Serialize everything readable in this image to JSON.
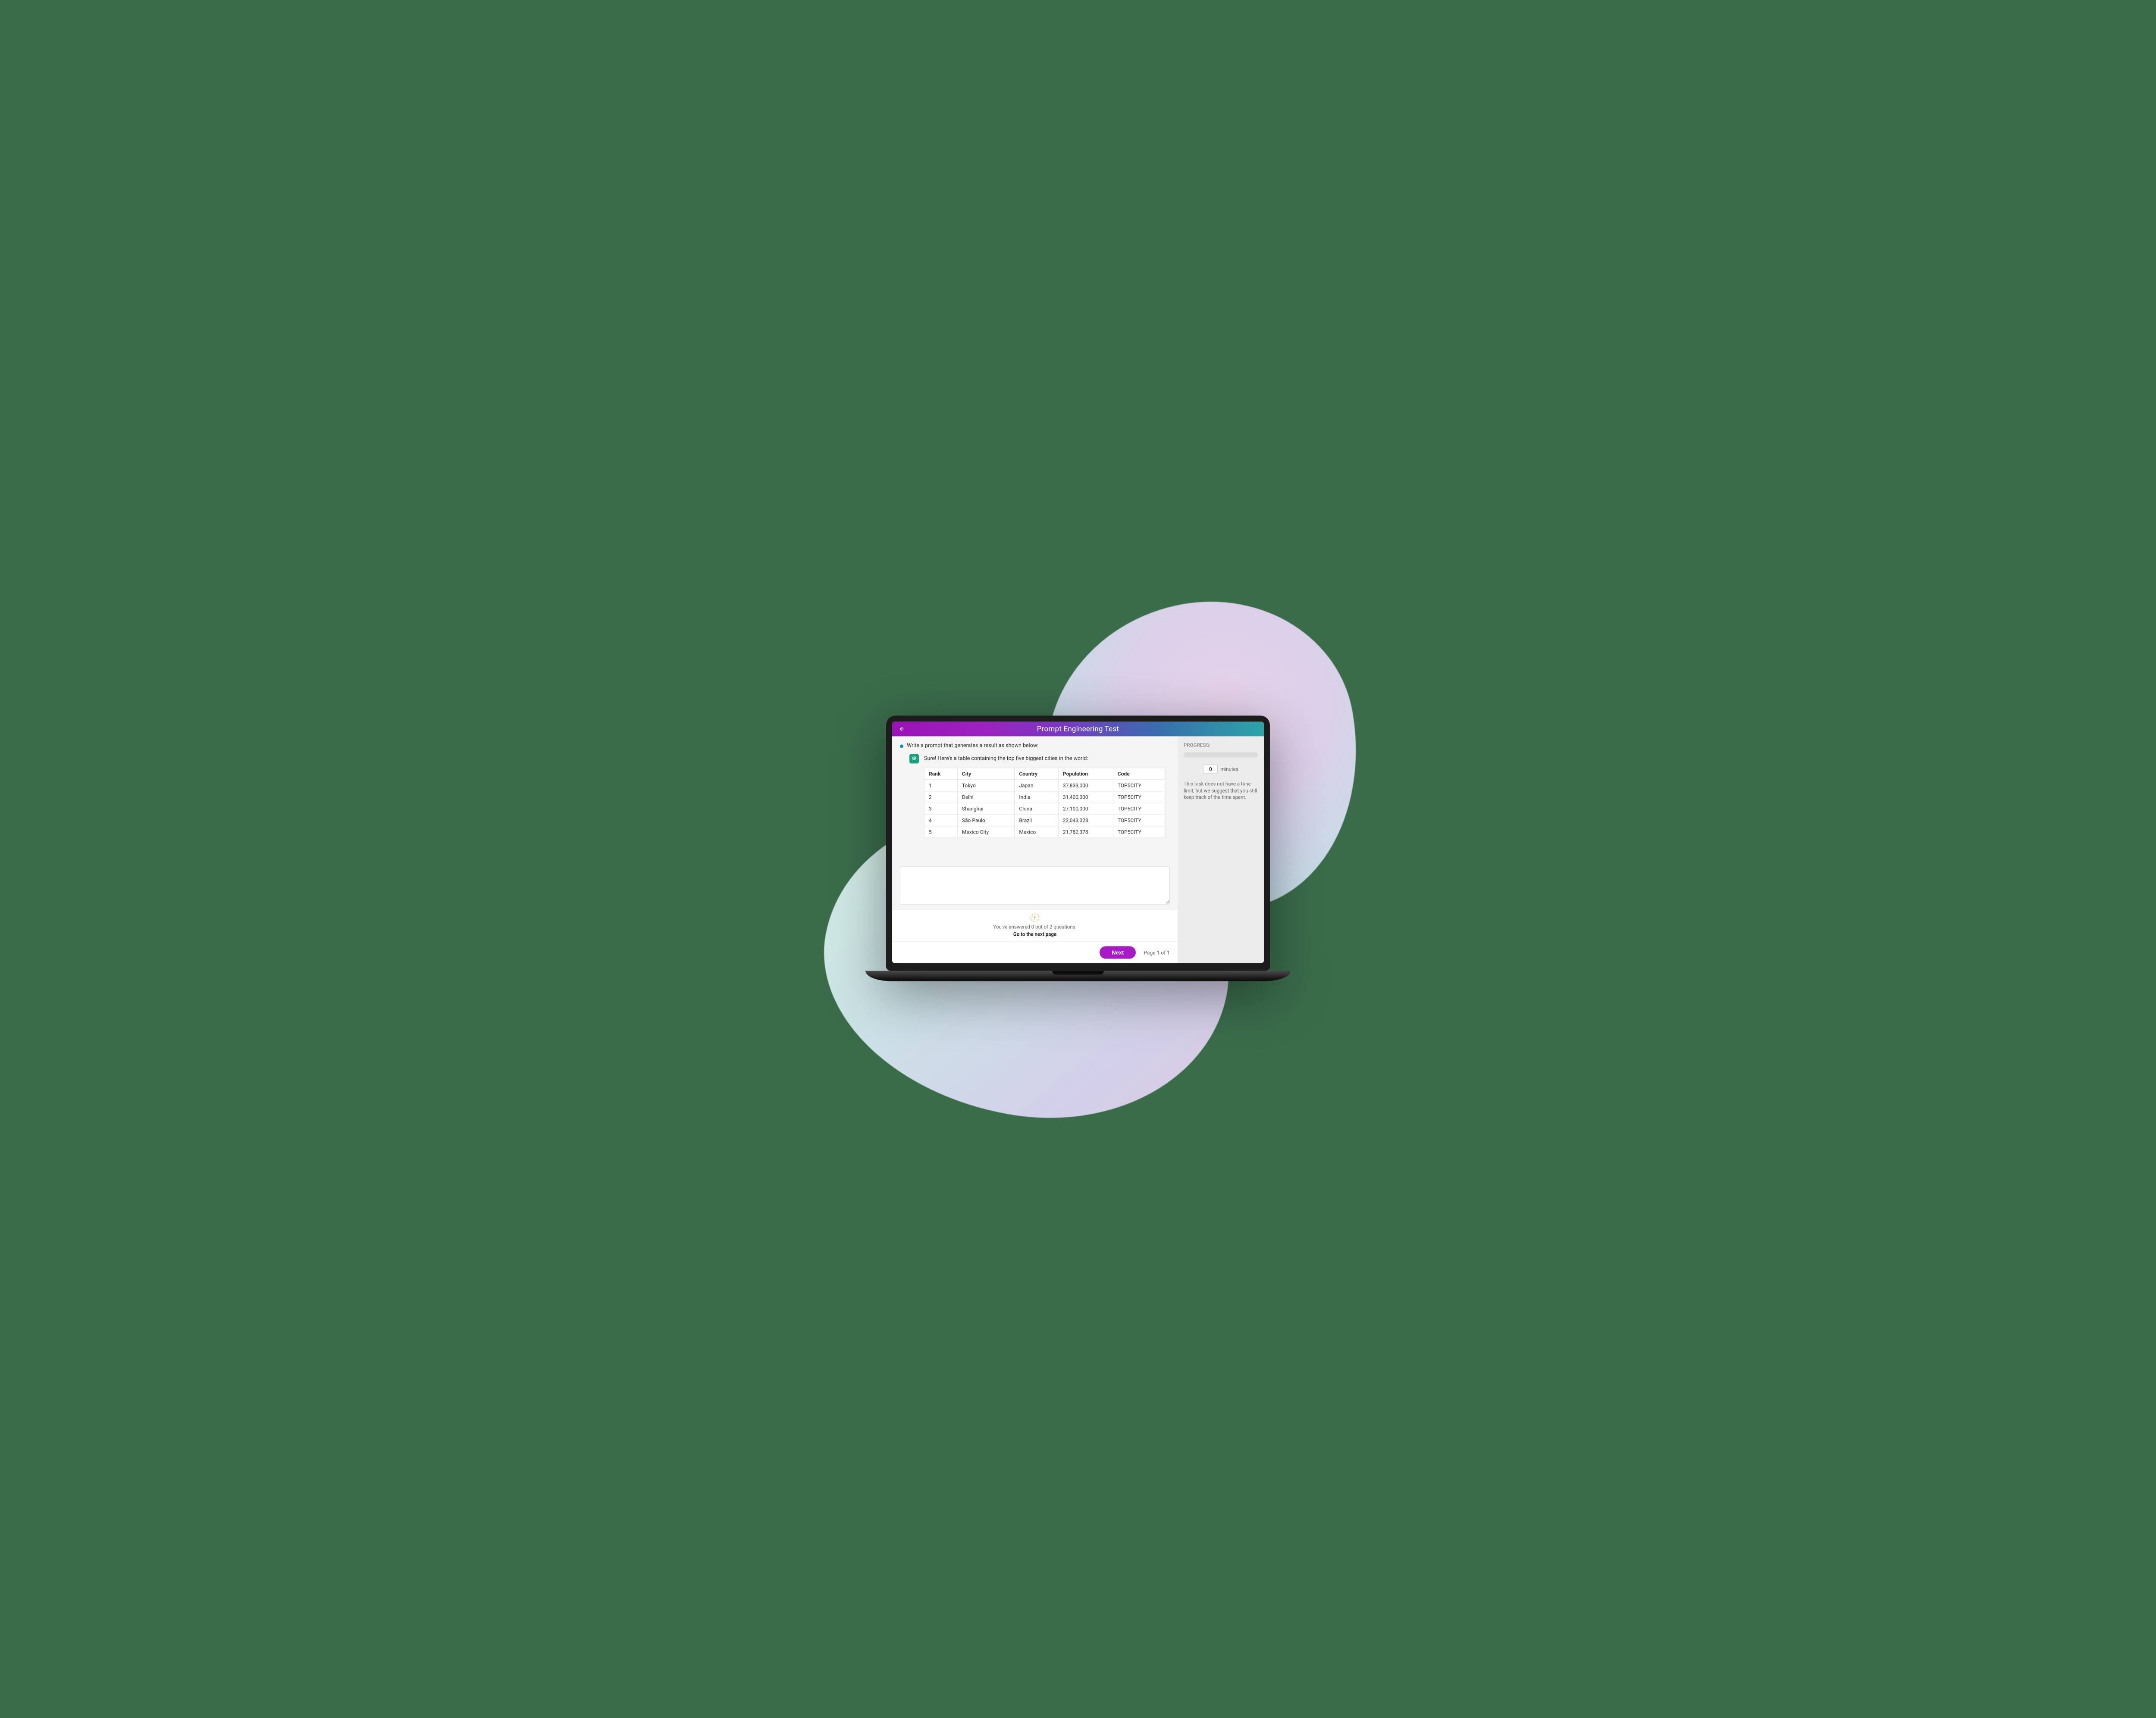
{
  "header": {
    "title": "Prompt Engineering Test"
  },
  "question": {
    "prompt": "Write a prompt that generates a result as shown below:",
    "responseIntro": "Sure! Here's a table containing the top five biggest cities in the world:"
  },
  "table": {
    "headers": [
      "Rank",
      "City",
      "Country",
      "Population",
      "Code"
    ],
    "rows": [
      [
        "1",
        "Tokyo",
        "Japan",
        "37,833,000",
        "TOP5CITY"
      ],
      [
        "2",
        "Delhi",
        "India",
        "31,400,000",
        "TOP5CITY"
      ],
      [
        "3",
        "Shanghai",
        "China",
        "27,100,000",
        "TOP5CITY"
      ],
      [
        "4",
        "São Paulo",
        "Brazil",
        "22,043,028",
        "TOP5CITY"
      ],
      [
        "5",
        "Mexico City",
        "Mexico",
        "21,782,378",
        "TOP5CITY"
      ]
    ]
  },
  "status": {
    "answeredLine": "You've answered 0 out of 2 questions.",
    "nextLine": "Go to the next page"
  },
  "footer": {
    "nextLabel": "Next",
    "pageInfo": "Page 1 of 1"
  },
  "sidebar": {
    "title": "PROGRESS:",
    "minutesValue": "0",
    "minutesLabel": "minutes",
    "note": "This task does not have a time limit, but we suggest that you still keep track of the time spent."
  }
}
